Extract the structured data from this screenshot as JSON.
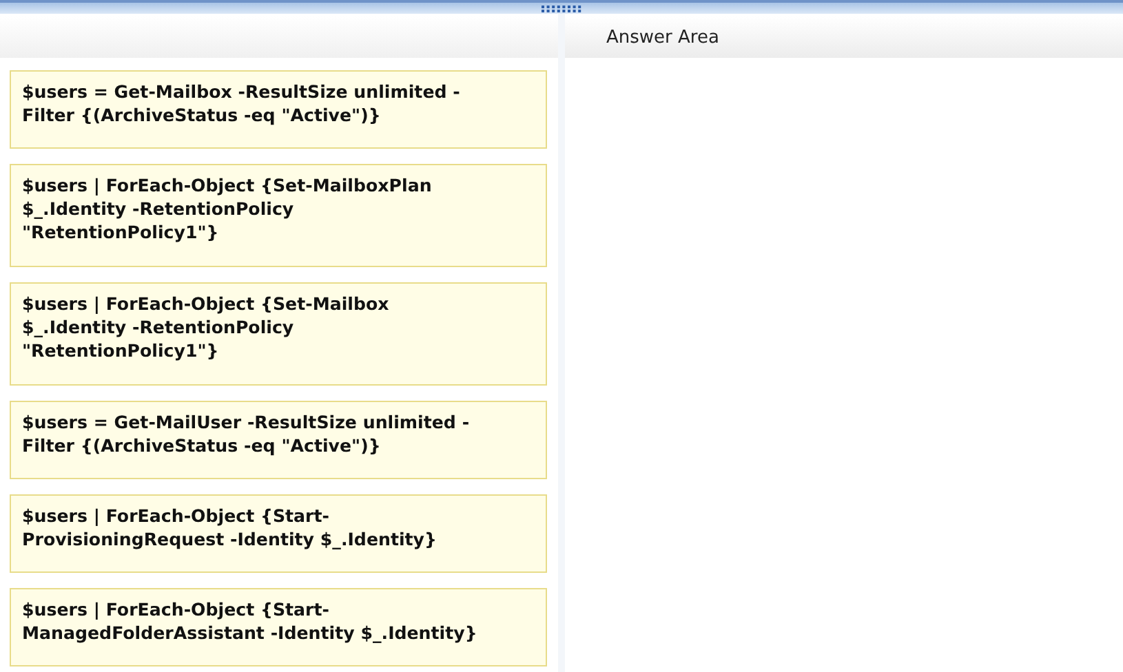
{
  "answer_area": {
    "title": "Answer Area"
  },
  "choices": [
    {
      "text": "$users = Get-Mailbox -ResultSize unlimited -\nFilter {(ArchiveStatus -eq \"Active\")}"
    },
    {
      "text": "$users | ForEach-Object {Set-MailboxPlan\n$_.Identity -RetentionPolicy\n\"RetentionPolicy1\"}"
    },
    {
      "text": "$users | ForEach-Object {Set-Mailbox\n$_.Identity -RetentionPolicy\n\"RetentionPolicy1\"}"
    },
    {
      "text": "$users = Get-MailUser -ResultSize unlimited -\nFilter {(ArchiveStatus -eq \"Active\")}"
    },
    {
      "text": "$users | ForEach-Object {Start-\nProvisioningRequest -Identity $_.Identity}"
    },
    {
      "text": "$users | ForEach-Object {Start-\nManagedFolderAssistant -Identity $_.Identity}"
    }
  ]
}
